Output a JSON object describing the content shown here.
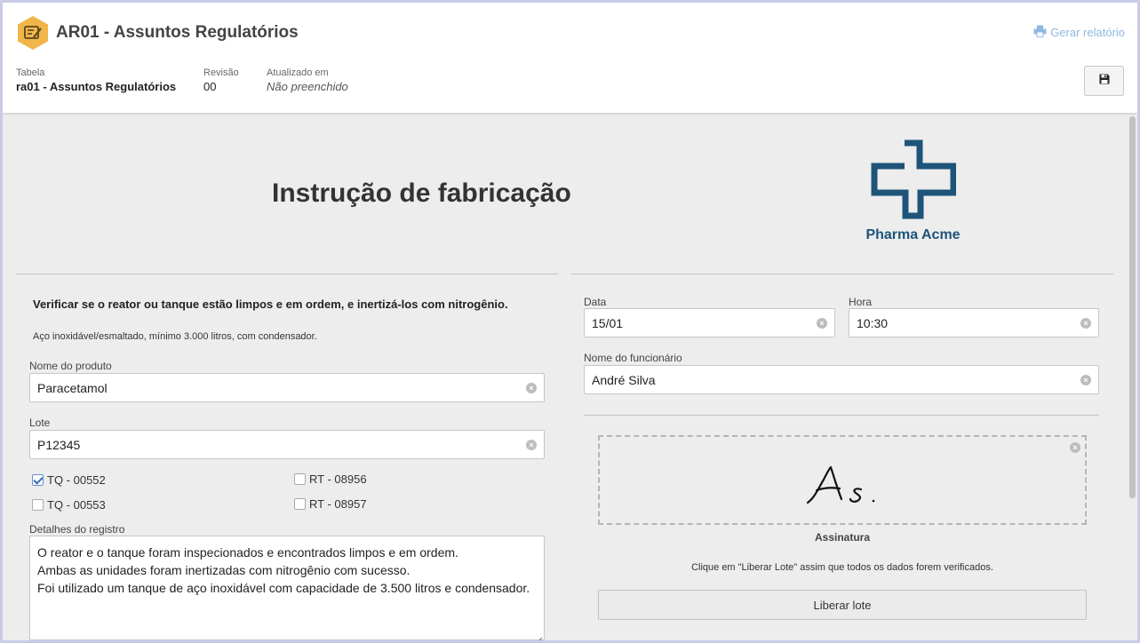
{
  "header": {
    "title": "AR01 - Assuntos Regulatórios",
    "report_link": "Gerar relatório",
    "meta": [
      {
        "label": "Tabela",
        "value": "ra01 - Assuntos Regulatórios"
      },
      {
        "label": "Revisão",
        "value": "00"
      },
      {
        "label": "Atualizado em",
        "value": "Não preenchido"
      }
    ],
    "icons": {
      "app": "edit-document-icon",
      "report": "printer-icon",
      "save": "floppy-disk-icon"
    },
    "accent_color": "#f0b64a"
  },
  "document": {
    "title": "Instrução de fabricação",
    "logo_text": "Pharma Acme",
    "logo_color": "#1e5479",
    "instruction": "Verificar se o reator ou tanque estão limpos e em ordem, e inertizá-los com nitrogênio.",
    "note": "Aço inoxidável/esmaltado, mínimo 3.000 litros, com condensador."
  },
  "form": {
    "product": {
      "label": "Nome do produto",
      "value": "Paracetamol"
    },
    "lot": {
      "label": "Lote",
      "value": "P12345"
    },
    "checkboxes": [
      {
        "label": "TQ - 00552",
        "checked": true
      },
      {
        "label": "RT - 08956",
        "checked": false
      },
      {
        "label": "TQ - 00553",
        "checked": false
      },
      {
        "label": "RT - 08957",
        "checked": false
      }
    ],
    "details": {
      "label": "Detalhes do registro",
      "lines": [
        "O reator e o tanque foram inspecionados e encontrados limpos e em ordem.",
        "Ambas as unidades foram inertizadas com nitrogênio com sucesso.",
        "Foi utilizado um tanque de aço inoxidável com capacidade de 3.500 litros e condensador."
      ]
    },
    "date": {
      "label": "Data",
      "value": "15/01"
    },
    "time": {
      "label": "Hora",
      "value": "10:30"
    },
    "employee": {
      "label": "Nome do funcionário",
      "value": "André Silva"
    },
    "signature": {
      "label": "Assinatura"
    },
    "hint": "Clique em \"Liberar Lote\" assim que todos os dados forem verificados.",
    "release_button": "Liberar lote"
  }
}
